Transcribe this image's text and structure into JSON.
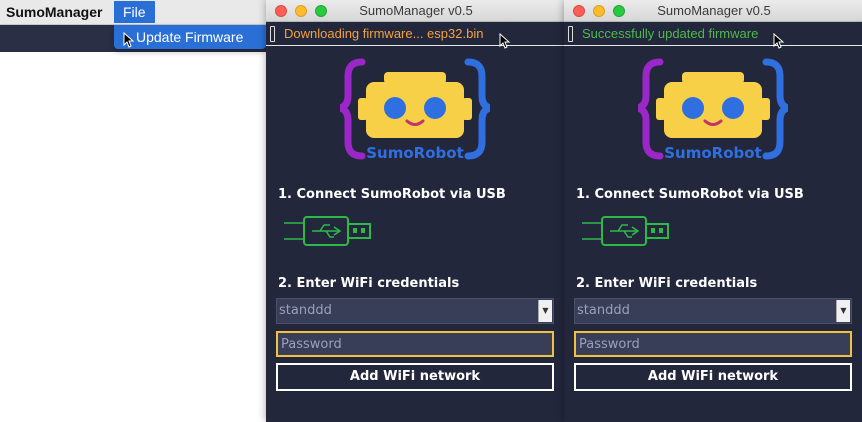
{
  "menubar": {
    "app_name": "SumoManager",
    "file_menu": "File",
    "dropdown_item": "Update Firmware"
  },
  "windows": [
    {
      "title": "SumoManager v0.5",
      "status": "Downloading firmware... esp32.bin",
      "status_color": "#f3a23b",
      "logo_text": "SumoRobot",
      "step1": "1. Connect SumoRobot via USB",
      "step2": "2. Enter WiFi credentials",
      "ssid_value": "standdd",
      "password_placeholder": "Password",
      "add_button": "Add WiFi network"
    },
    {
      "title": "SumoManager v0.5",
      "status": "Successfully updated firmware",
      "status_color": "#4fb94f",
      "logo_text": "SumoRobot",
      "step1": "1. Connect SumoRobot via USB",
      "step2": "2. Enter WiFi credentials",
      "ssid_value": "standdd",
      "password_placeholder": "Password",
      "add_button": "Add WiFi network"
    }
  ],
  "colors": {
    "window_bg": "#23273c",
    "brace_left": "#9b27c9",
    "brace_right": "#2f6fe0",
    "robot_yellow": "#f7d048",
    "eye_blue": "#2f6fe0",
    "usb_green": "#2fb84a",
    "focus_border": "#f0c040"
  }
}
